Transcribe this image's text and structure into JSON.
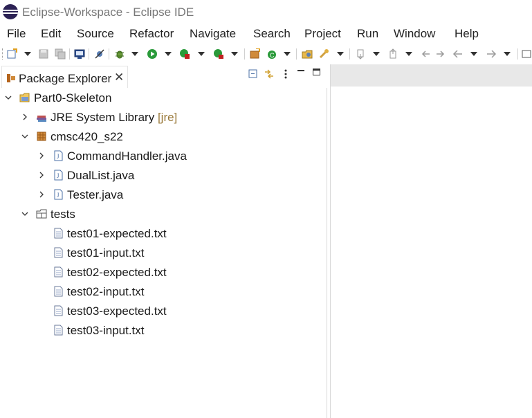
{
  "window": {
    "title": "Eclipse-Workspace - Eclipse IDE"
  },
  "menu": {
    "items": [
      "File",
      "Edit",
      "Source",
      "Refactor",
      "Navigate",
      "Search",
      "Project",
      "Run",
      "Window",
      "Help"
    ]
  },
  "toolbar": {
    "icons": [
      "new-icon",
      "save-icon",
      "save-all-icon",
      "terminal-icon",
      "skip-breakpoints-icon",
      "debug-icon",
      "run-icon",
      "coverage-icon",
      "run-last-icon",
      "new-java-package-icon",
      "new-java-class-icon",
      "open-type-icon",
      "open-task-icon",
      "next-annotation-icon",
      "previous-annotation-icon",
      "last-edit-location-icon",
      "back-icon",
      "forward-icon"
    ]
  },
  "explorer": {
    "tab_label": "Package Explorer",
    "tab_close": "✕",
    "tree": {
      "project": "Part0-Skeleton",
      "jre_label": "JRE System Library",
      "jre_decoration": "[jre]",
      "package": "cmsc420_s22",
      "files": [
        "CommandHandler.java",
        "DualList.java",
        "Tester.java"
      ],
      "folder": "tests",
      "test_files": [
        "test01-expected.txt",
        "test01-input.txt",
        "test02-expected.txt",
        "test02-input.txt",
        "test03-expected.txt",
        "test03-input.txt"
      ]
    }
  },
  "colors": {
    "accent": "#2c2255",
    "eclipse_orange": "#f7941e",
    "package_icon": "#b5651d",
    "java_icon": "#4a6fa5",
    "run_green": "#2a9a3a"
  }
}
